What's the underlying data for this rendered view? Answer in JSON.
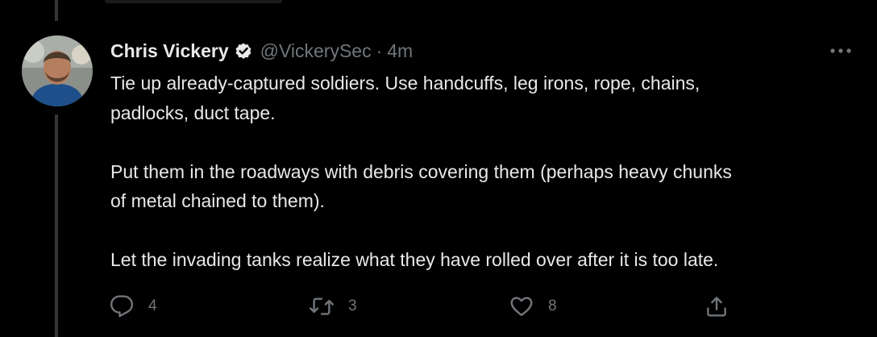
{
  "tweet": {
    "author": {
      "display_name": "Chris Vickery",
      "handle": "@VickerySec",
      "verified": true
    },
    "separator": "·",
    "time": "4m",
    "paragraphs": [
      [
        "Tie up already-captured soldiers. Use handcuffs, leg irons, rope, chains,",
        "padlocks, duct tape."
      ],
      [
        "Put them in the roadways with debris covering them (perhaps heavy chunks",
        "of metal chained to them)."
      ],
      [
        "Let the invading tanks realize what they have rolled over after it is too late."
      ]
    ],
    "actions": {
      "replies": "4",
      "retweets": "3",
      "likes": "8"
    }
  },
  "icons": {
    "verified": "verified-badge-icon",
    "more": "more-horizontal-icon",
    "reply": "reply-bubble-icon",
    "retweet": "retweet-arrows-icon",
    "like": "heart-icon",
    "share": "share-upload-icon"
  },
  "colors": {
    "background": "#000000",
    "text_primary": "#e7e9ea",
    "text_secondary": "#71767b",
    "thread_line": "#333639"
  }
}
